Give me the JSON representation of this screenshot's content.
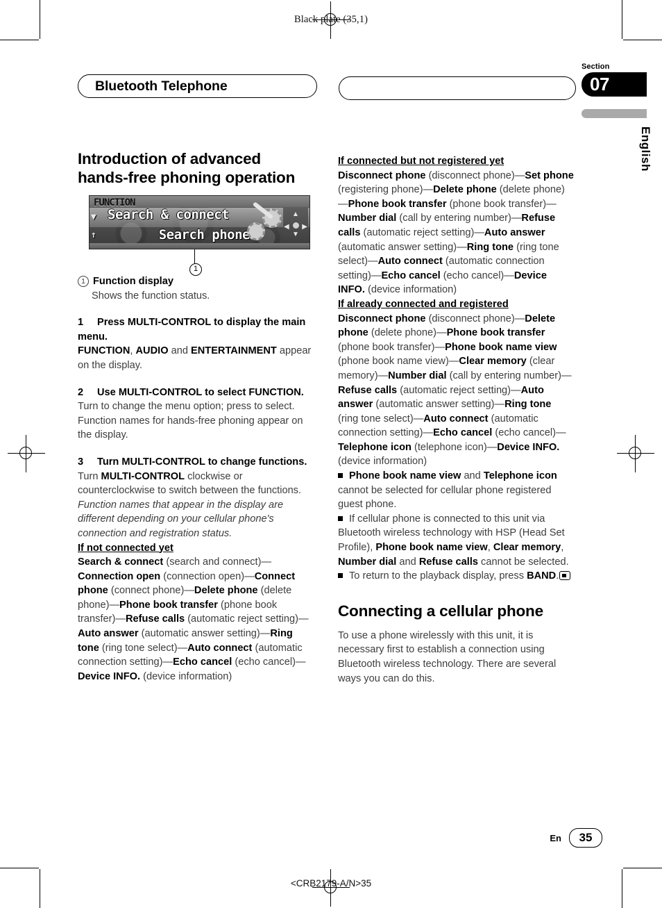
{
  "print_marks": {
    "black_plate": "Black plate (35,1)",
    "footer_code": "<CRB2179-A/N>35"
  },
  "section_tab": {
    "section_word": "Section",
    "section_number": "07",
    "language": "English",
    "accent_color": "#000000",
    "bar_color": "#a9a9a9"
  },
  "chapter": {
    "title": "Bluetooth Telephone"
  },
  "left_column": {
    "heading": "Introduction of advanced hands-free phoning operation",
    "figure": {
      "lcd_header": "FUNCTION",
      "lcd_line1": "Search & connect",
      "lcd_line2": "Search phone",
      "lcd_side_chars": "▼↕",
      "callout_number": "1"
    },
    "callout": {
      "number": "1",
      "label": "Function display",
      "description": "Shows the function status."
    },
    "steps": [
      {
        "number": "1",
        "title": "Press MULTI-CONTROL to display the main menu.",
        "body_parts": [
          {
            "t": "FUNCTION",
            "bold": true
          },
          {
            "t": ", ",
            "bold": false
          },
          {
            "t": "AUDIO",
            "bold": true
          },
          {
            "t": " and ",
            "bold": false
          },
          {
            "t": "ENTERTAINMENT",
            "bold": true
          },
          {
            "t": " appear on the display.",
            "bold": false
          }
        ]
      },
      {
        "number": "2",
        "title": "Use MULTI-CONTROL to select FUNCTION.",
        "body_text_1": "Turn to change the menu option; press to select.",
        "body_text_2": "Function names for hands-free phoning appear on the display."
      },
      {
        "number": "3",
        "title": "Turn MULTI-CONTROL to change functions."
      }
    ],
    "step3_body": {
      "line_pre": "Turn ",
      "line_bold": "MULTI-CONTROL",
      "line_post": " clockwise or counterclockwise to switch between the functions.",
      "italic_note": "Function names that appear in the display are different depending on your cellular phone's connection and registration status."
    },
    "not_connected": {
      "subhead": "If not connected yet",
      "items": [
        {
          "bold": "Search & connect",
          "paren": "(search and connect)"
        },
        {
          "bold": "Connection open",
          "paren": "(connection open)"
        },
        {
          "bold": "Connect phone",
          "paren": "(connect phone)"
        },
        {
          "bold": "Delete phone",
          "paren": "(delete phone)"
        },
        {
          "bold": "Phone book transfer",
          "paren": "(phone book transfer)"
        },
        {
          "bold": "Refuse calls",
          "paren": "(automatic reject setting)"
        },
        {
          "bold": "Auto answer",
          "paren": "(automatic answer setting)"
        },
        {
          "bold": "Ring tone",
          "paren": "(ring tone select)"
        },
        {
          "bold": "Auto connect",
          "paren": "(automatic connection setting)"
        },
        {
          "bold": "Echo cancel",
          "paren": "(echo cancel)"
        },
        {
          "bold": "Device INFO.",
          "paren": "(device information)"
        }
      ]
    }
  },
  "right_column": {
    "connected_not_registered": {
      "subhead": "If connected but not registered yet",
      "items": [
        {
          "bold": "Disconnect phone",
          "paren": "(disconnect phone)"
        },
        {
          "bold": "Set phone",
          "paren": "(registering phone)"
        },
        {
          "bold": "Delete phone",
          "paren": "(delete phone)"
        },
        {
          "bold": "Phone book transfer",
          "paren": "(phone book transfer)"
        },
        {
          "bold": "Number dial",
          "paren": "(call by entering number)"
        },
        {
          "bold": "Refuse calls",
          "paren": "(automatic reject setting)"
        },
        {
          "bold": "Auto answer",
          "paren": "(automatic answer setting)"
        },
        {
          "bold": "Ring tone",
          "paren": "(ring tone select)"
        },
        {
          "bold": "Auto connect",
          "paren": "(automatic connection setting)"
        },
        {
          "bold": "Echo cancel",
          "paren": "(echo cancel)"
        },
        {
          "bold": "Device INFO.",
          "paren": "(device information)"
        }
      ]
    },
    "already_connected": {
      "subhead": "If already connected and registered",
      "items": [
        {
          "bold": "Disconnect phone",
          "paren": "(disconnect phone)"
        },
        {
          "bold": "Delete phone",
          "paren": "(delete phone)"
        },
        {
          "bold": "Phone book transfer",
          "paren": "(phone book transfer)"
        },
        {
          "bold": "Phone book name view",
          "paren": "(phone book name view)"
        },
        {
          "bold": "Clear memory",
          "paren": "(clear memory)"
        },
        {
          "bold": "Number dial",
          "paren": "(call by entering number)"
        },
        {
          "bold": "Refuse calls",
          "paren": "(automatic reject setting)"
        },
        {
          "bold": "Auto answer",
          "paren": "(automatic answer setting)"
        },
        {
          "bold": "Ring tone",
          "paren": "(ring tone select)"
        },
        {
          "bold": "Auto connect",
          "paren": "(automatic connection setting)"
        },
        {
          "bold": "Echo cancel",
          "paren": "(echo cancel)"
        },
        {
          "bold": "Telephone icon",
          "paren": "(telephone icon)"
        },
        {
          "bold": "Device INFO.",
          "paren": "(device information)"
        }
      ]
    },
    "notes": [
      {
        "parts": [
          {
            "t": "Phone book name view",
            "bold": true
          },
          {
            "t": " and ",
            "bold": false
          },
          {
            "t": "Telephone icon",
            "bold": true
          },
          {
            "t": " cannot be selected for cellular phone registered guest phone.",
            "bold": false
          }
        ]
      },
      {
        "parts": [
          {
            "t": "If cellular phone is connected to this unit via Bluetooth wireless technology with HSP (Head Set Profile), ",
            "bold": false
          },
          {
            "t": "Phone book name view",
            "bold": true
          },
          {
            "t": ", ",
            "bold": false
          },
          {
            "t": "Clear memory",
            "bold": true
          },
          {
            "t": ", ",
            "bold": false
          },
          {
            "t": "Number dial",
            "bold": true
          },
          {
            "t": " and ",
            "bold": false
          },
          {
            "t": "Refuse calls",
            "bold": true
          },
          {
            "t": " cannot be selected.",
            "bold": false
          }
        ]
      },
      {
        "parts": [
          {
            "t": "To return to the playback display, press ",
            "bold": false
          },
          {
            "t": "BAND",
            "bold": true
          },
          {
            "t": ".",
            "bold": false
          }
        ],
        "trailing_icon": "band-button-icon"
      }
    ],
    "connecting_section": {
      "heading": "Connecting a cellular phone",
      "body": "To use a phone wirelessly with this unit, it is necessary first to establish a connection using Bluetooth wireless technology. There are several ways you can do this."
    }
  },
  "page_footer": {
    "lang_code": "En",
    "page_number": "35"
  }
}
